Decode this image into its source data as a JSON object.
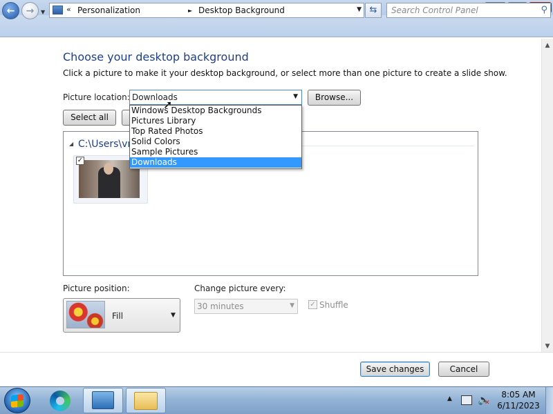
{
  "window": {
    "minimize_glyph": "—",
    "maximize_glyph": "❐",
    "close_glyph": "✕"
  },
  "nav": {
    "back_glyph": "←",
    "forward_glyph": "→",
    "address_chevron": "«",
    "breadcrumb": [
      "Personalization",
      "Desktop Background"
    ],
    "breadcrumb_separator": "►",
    "refresh_glyph": "⇆",
    "search_placeholder": "Search Control Panel",
    "search_icon": "search-icon"
  },
  "content": {
    "heading": "Choose your desktop background",
    "subtitle": "Click a picture to make it your desktop background, or select more than one picture to create a slide show.",
    "picture_location_label": "Picture location:",
    "picture_location_value": "Downloads",
    "browse_label": "Browse...",
    "select_all_label": "Select all",
    "dropdown_options": [
      "Windows Desktop Backgrounds",
      "Pictures Library",
      "Top Rated Photos",
      "Solid Colors",
      "Sample Pictures",
      "Downloads"
    ],
    "dropdown_selected_index": 5,
    "group_label": "C:\\Users\\vm",
    "thumbnail_checked": true,
    "picture_position_label": "Picture position:",
    "picture_position_value": "Fill",
    "change_picture_label": "Change picture every:",
    "change_picture_value": "30 minutes",
    "shuffle_label": "Shuffle",
    "shuffle_checked": true,
    "save_label": "Save changes",
    "cancel_label": "Cancel"
  },
  "taskbar": {
    "time": "8:05 AM",
    "date": "6/11/2023",
    "apps": [
      "edge-icon",
      "control-panel-icon",
      "file-explorer-icon"
    ]
  },
  "colors": {
    "heading": "#1e3f87",
    "selection": "#3399ff",
    "taskbar": "#94b4d6"
  }
}
